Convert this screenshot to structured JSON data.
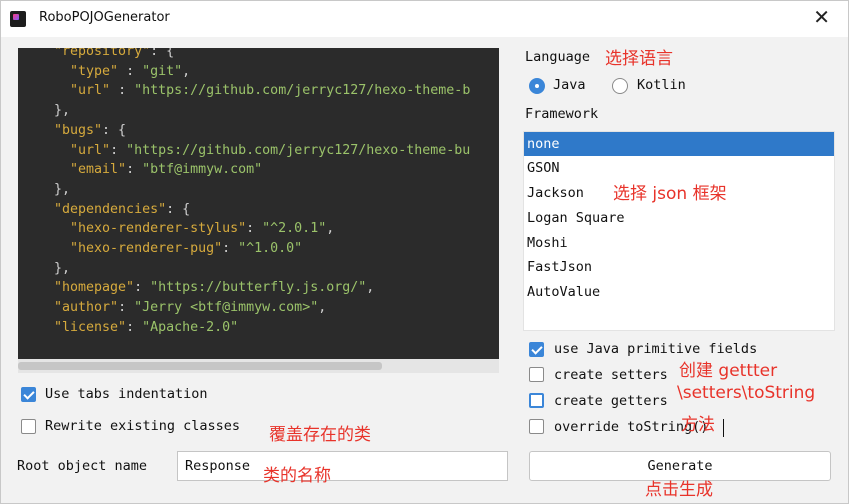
{
  "window": {
    "title": "RoboPOJOGenerator",
    "close_glyph": "✕"
  },
  "editor": {
    "lines": [
      [
        [
          "k",
          "  \"repository\""
        ],
        [
          "p",
          ": {"
        ]
      ],
      [
        [
          "k",
          "    \"type\""
        ],
        [
          "p",
          " : "
        ],
        [
          "s",
          "\"git\""
        ],
        [
          "p",
          ","
        ]
      ],
      [
        [
          "k",
          "    \"url\""
        ],
        [
          "p",
          " : "
        ],
        [
          "s",
          "\"https://github.com/jerryc127/hexo-theme-b"
        ]
      ],
      [
        [
          "p",
          "  },"
        ]
      ],
      [
        [
          "k",
          "  \"bugs\""
        ],
        [
          "p",
          ": {"
        ]
      ],
      [
        [
          "k",
          "    \"url\""
        ],
        [
          "p",
          ": "
        ],
        [
          "s",
          "\"https://github.com/jerryc127/hexo-theme-bu"
        ]
      ],
      [
        [
          "k",
          "    \"email\""
        ],
        [
          "p",
          ": "
        ],
        [
          "s",
          "\"btf@immyw.com\""
        ]
      ],
      [
        [
          "p",
          "  },"
        ]
      ],
      [
        [
          "k",
          "  \"dependencies\""
        ],
        [
          "p",
          ": {"
        ]
      ],
      [
        [
          "k",
          "    \"hexo-renderer-stylus\""
        ],
        [
          "p",
          ": "
        ],
        [
          "s",
          "\"^2.0.1\""
        ],
        [
          "p",
          ","
        ]
      ],
      [
        [
          "k",
          "    \"hexo-renderer-pug\""
        ],
        [
          "p",
          ": "
        ],
        [
          "s",
          "\"^1.0.0\""
        ]
      ],
      [
        [
          "p",
          "  },"
        ]
      ],
      [
        [
          "k",
          "  \"homepage\""
        ],
        [
          "p",
          ": "
        ],
        [
          "s",
          "\"https://butterfly.js.org/\""
        ],
        [
          "p",
          ","
        ]
      ],
      [
        [
          "k",
          "  \"author\""
        ],
        [
          "p",
          ": "
        ],
        [
          "s",
          "\"Jerry <btf@immyw.com>\""
        ],
        [
          "p",
          ","
        ]
      ],
      [
        [
          "k",
          "  \"license\""
        ],
        [
          "p",
          ": "
        ],
        [
          "s",
          "\"Apache-2.0\""
        ]
      ],
      [
        [
          "p",
          ""
        ]
      ],
      [
        [
          "p",
          "}"
        ]
      ]
    ]
  },
  "left_options": {
    "use_tabs": {
      "label": "Use tabs indentation",
      "checked": true
    },
    "rewrite": {
      "label": "Rewrite existing classes",
      "checked": false,
      "annotation": "覆盖存在的类"
    },
    "root_object": {
      "label": "Root object name",
      "value": "Response",
      "annotation": "类的名称"
    }
  },
  "language": {
    "label": "Language",
    "annotation": "选择语言",
    "options": [
      "Java",
      "Kotlin"
    ],
    "selected": "Java"
  },
  "framework": {
    "label": "Framework",
    "annotation": "选择 json 框架",
    "items": [
      "none",
      "GSON",
      "Jackson",
      "Logan Square",
      "Moshi",
      "FastJson",
      "AutoValue"
    ],
    "selected": "none"
  },
  "right_options": {
    "primitive": {
      "label": "use Java primitive fields",
      "checked": true
    },
    "setters": {
      "label": "create setters",
      "checked": false
    },
    "getters": {
      "label": "create getters",
      "checked": false
    },
    "tostring": {
      "label": "override toString()",
      "checked": false
    },
    "annotation_line1": "创建 gettter",
    "annotation_line2": "\\setters\\toString",
    "annotation_line3": "方法"
  },
  "generate": {
    "label": "Generate",
    "annotation": "点击生成"
  },
  "colors": {
    "accent": "#2f79c9",
    "annotation": "#e8332a",
    "editor_bg": "#2b2b2b"
  }
}
